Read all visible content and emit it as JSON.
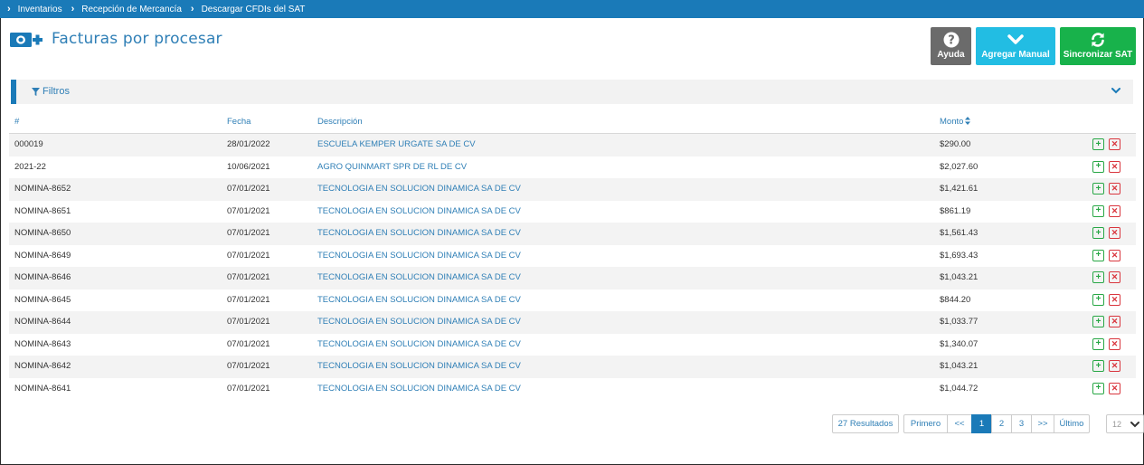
{
  "breadcrumb": [
    "Inventarios",
    "Recepción de Mercancía",
    "Descargar CFDIs del SAT"
  ],
  "header": {
    "title": "Facturas por procesar",
    "logo_icon": "invoice-plus-icon"
  },
  "buttons": {
    "help": "Ayuda",
    "manual": "Agregar Manual",
    "sync": "Sincronizar SAT"
  },
  "filters": {
    "label": "Filtros"
  },
  "table": {
    "headers": {
      "num": "#",
      "date": "Fecha",
      "desc": "Descripción",
      "amount": "Monto"
    },
    "rows": [
      {
        "num": "000019",
        "date": "28/01/2022",
        "desc": "ESCUELA KEMPER URGATE SA DE CV",
        "amount": "$290.00"
      },
      {
        "num": "2021-22",
        "date": "10/06/2021",
        "desc": "AGRO QUINMART SPR DE RL DE CV",
        "amount": "$2,027.60"
      },
      {
        "num": "NOMINA-8652",
        "date": "07/01/2021",
        "desc": "TECNOLOGIA EN SOLUCION DINAMICA SA DE CV",
        "amount": "$1,421.61"
      },
      {
        "num": "NOMINA-8651",
        "date": "07/01/2021",
        "desc": "TECNOLOGIA EN SOLUCION DINAMICA SA DE CV",
        "amount": "$861.19"
      },
      {
        "num": "NOMINA-8650",
        "date": "07/01/2021",
        "desc": "TECNOLOGIA EN SOLUCION DINAMICA SA DE CV",
        "amount": "$1,561.43"
      },
      {
        "num": "NOMINA-8649",
        "date": "07/01/2021",
        "desc": "TECNOLOGIA EN SOLUCION DINAMICA SA DE CV",
        "amount": "$1,693.43"
      },
      {
        "num": "NOMINA-8646",
        "date": "07/01/2021",
        "desc": "TECNOLOGIA EN SOLUCION DINAMICA SA DE CV",
        "amount": "$1,043.21"
      },
      {
        "num": "NOMINA-8645",
        "date": "07/01/2021",
        "desc": "TECNOLOGIA EN SOLUCION DINAMICA SA DE CV",
        "amount": "$844.20"
      },
      {
        "num": "NOMINA-8644",
        "date": "07/01/2021",
        "desc": "TECNOLOGIA EN SOLUCION DINAMICA SA DE CV",
        "amount": "$1,033.77"
      },
      {
        "num": "NOMINA-8643",
        "date": "07/01/2021",
        "desc": "TECNOLOGIA EN SOLUCION DINAMICA SA DE CV",
        "amount": "$1,340.07"
      },
      {
        "num": "NOMINA-8642",
        "date": "07/01/2021",
        "desc": "TECNOLOGIA EN SOLUCION DINAMICA SA DE CV",
        "amount": "$1,043.21"
      },
      {
        "num": "NOMINA-8641",
        "date": "07/01/2021",
        "desc": "TECNOLOGIA EN SOLUCION DINAMICA SA DE CV",
        "amount": "$1,044.72"
      }
    ]
  },
  "pagination": {
    "results": "27 Resultados",
    "first": "Primero",
    "prev": "<<",
    "pages": [
      "1",
      "2",
      "3"
    ],
    "active_page": "1",
    "next": ">>",
    "last": "Último",
    "page_size": "12"
  },
  "colors": {
    "primary": "#1a7ab8",
    "help": "#6b6b6b",
    "manual": "#22bde3",
    "sync": "#18b24b",
    "add": "#28a745",
    "remove": "#d9363e"
  }
}
